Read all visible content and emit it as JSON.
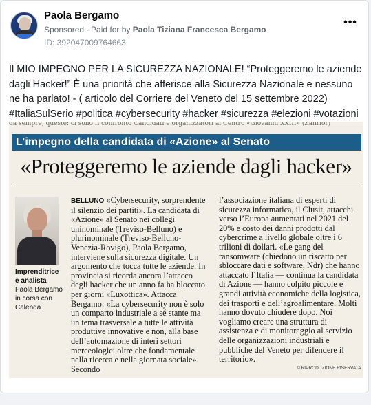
{
  "post": {
    "author": "Paola Bergamo",
    "sponsored": "Sponsored",
    "paid_prefix": "Paid for by",
    "paid_by": "Paola Tiziana Francesca Bergamo",
    "ad_id": "ID: 392047009764663",
    "more_icon": "more-horizontal-icon",
    "text": "Il MIO IMPEGNO PER LA SICUREZZA NAZIONALE! “Proteggeremo le aziende dagli Hacker!” È una priorità che afferisce alla Sicurezza Nazionale e nessuno ne ha parlato! - ( articolo del Corriere del Veneto del 15 settembre 2022) #ItaliaSulSerio #politica #cybersecurity #hacker #sicurezza #elezioni #votazioni"
  },
  "article": {
    "cut_text": "da sempre, queste: ci sono     Il confronto Candidati e organizzatori al Centro «Giovanni XXIII» (Zahrior)",
    "band_title": "L’impegno della candidata di «Azione» al Senato",
    "headline": "«Proteggeremo le aziende dagli hacker»",
    "caption_bold": "Imprenditrice e analista",
    "caption_text": "Paola Bergamo in corsa con Calenda",
    "kicker": "BELLUNO",
    "col1_text": " «Cybersecurity, sorprendente il silenzio dei partiti». La candidata di «Azione» al Senato nei collegi uninominale (Treviso-Belluno) e plurinominale (Treviso-Belluno-Venezia-Rovigo), Paola Bergamo, interviene sulla sicurezza digitale. Un argomento che tocca tutte le aziende. In provincia si ricorda ancora l’attacco degli hacker che un anno fa ha bloccato per giorni «Luxottica». Attacca Bergamo: «La cybersecurity non è solo un comparto industriale a sé stante ma un tema trasversale a tutte le attività produttive innovative e non, alla base dell’automazione di interi settori merceologici oltre che fondamentale nella ricerca e nella giornata sociale». Secondo",
    "col2_text": "l’associazione italiana di esperti di sicurezza informatica, il Clusit, attacchi verso l’Europa aumentati nel 2021 del 20% e costo dei danni prodotti dal cybercrime a livello globale oltre i 6 trilioni di dollari. «Le gang del ransomware (chiedono un riscatto per sbloccare dati e software, Ndr) che hanno attaccato l’Italia — continua la candidata di Azione — hanno colpito piccole e grandi attività economiche della logistica, dei trasporti e dell’agroalimentare. Molti hanno dovuto chiudere dopo. Noi vogliamo creare una struttura di assistenza e di monitoraggio al servizio delle organizzazioni industriali e pubbliche del Veneto per difendere il territorio».",
    "reserved": "© RIPRODUZIONE RISERVATA"
  },
  "colors": {
    "band": "#1d5d8a",
    "paper": "#f3efe6",
    "meta_text": "#65676b"
  }
}
